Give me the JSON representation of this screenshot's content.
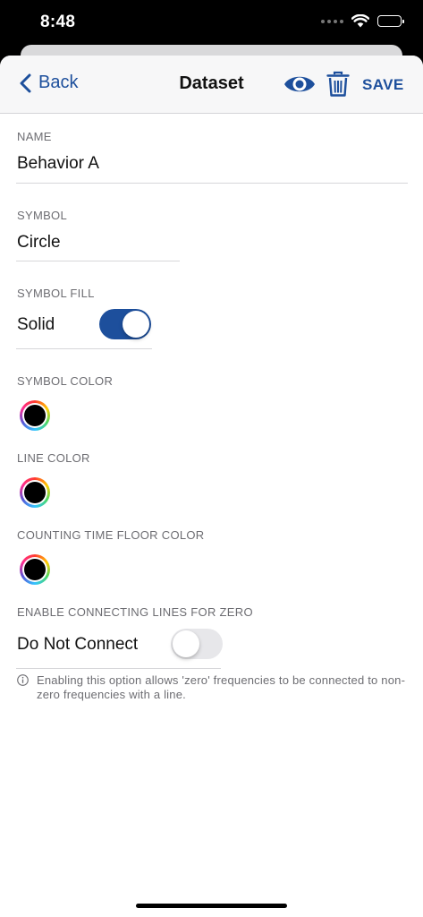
{
  "status_bar": {
    "time": "8:48",
    "icons": [
      "signal-icon",
      "wifi-icon",
      "battery-icon"
    ]
  },
  "navbar": {
    "back_label": "Back",
    "title": "Dataset",
    "save_label": "SAVE",
    "icons": [
      "chevron-left-icon",
      "eye-icon",
      "trash-icon"
    ]
  },
  "colors": {
    "accent": "#1d4f9c",
    "toggle_off": "#e7e7ea",
    "swatch_color": "#000000"
  },
  "form": {
    "name": {
      "label": "NAME",
      "value": "Behavior A"
    },
    "symbol": {
      "label": "SYMBOL",
      "value": "Circle"
    },
    "symbol_fill": {
      "label": "SYMBOL FILL",
      "value": "Solid",
      "toggle_on": true
    },
    "symbol_color": {
      "label": "SYMBOL COLOR"
    },
    "line_color": {
      "label": "LINE COLOR"
    },
    "counting_time_floor_color": {
      "label": "COUNTING TIME FLOOR COLOR"
    },
    "connect_zero": {
      "label": "ENABLE CONNECTING LINES FOR ZERO",
      "value": "Do Not Connect",
      "toggle_on": false,
      "help": "Enabling this option allows 'zero' frequencies to be connected to non-zero frequencies with a line."
    }
  }
}
